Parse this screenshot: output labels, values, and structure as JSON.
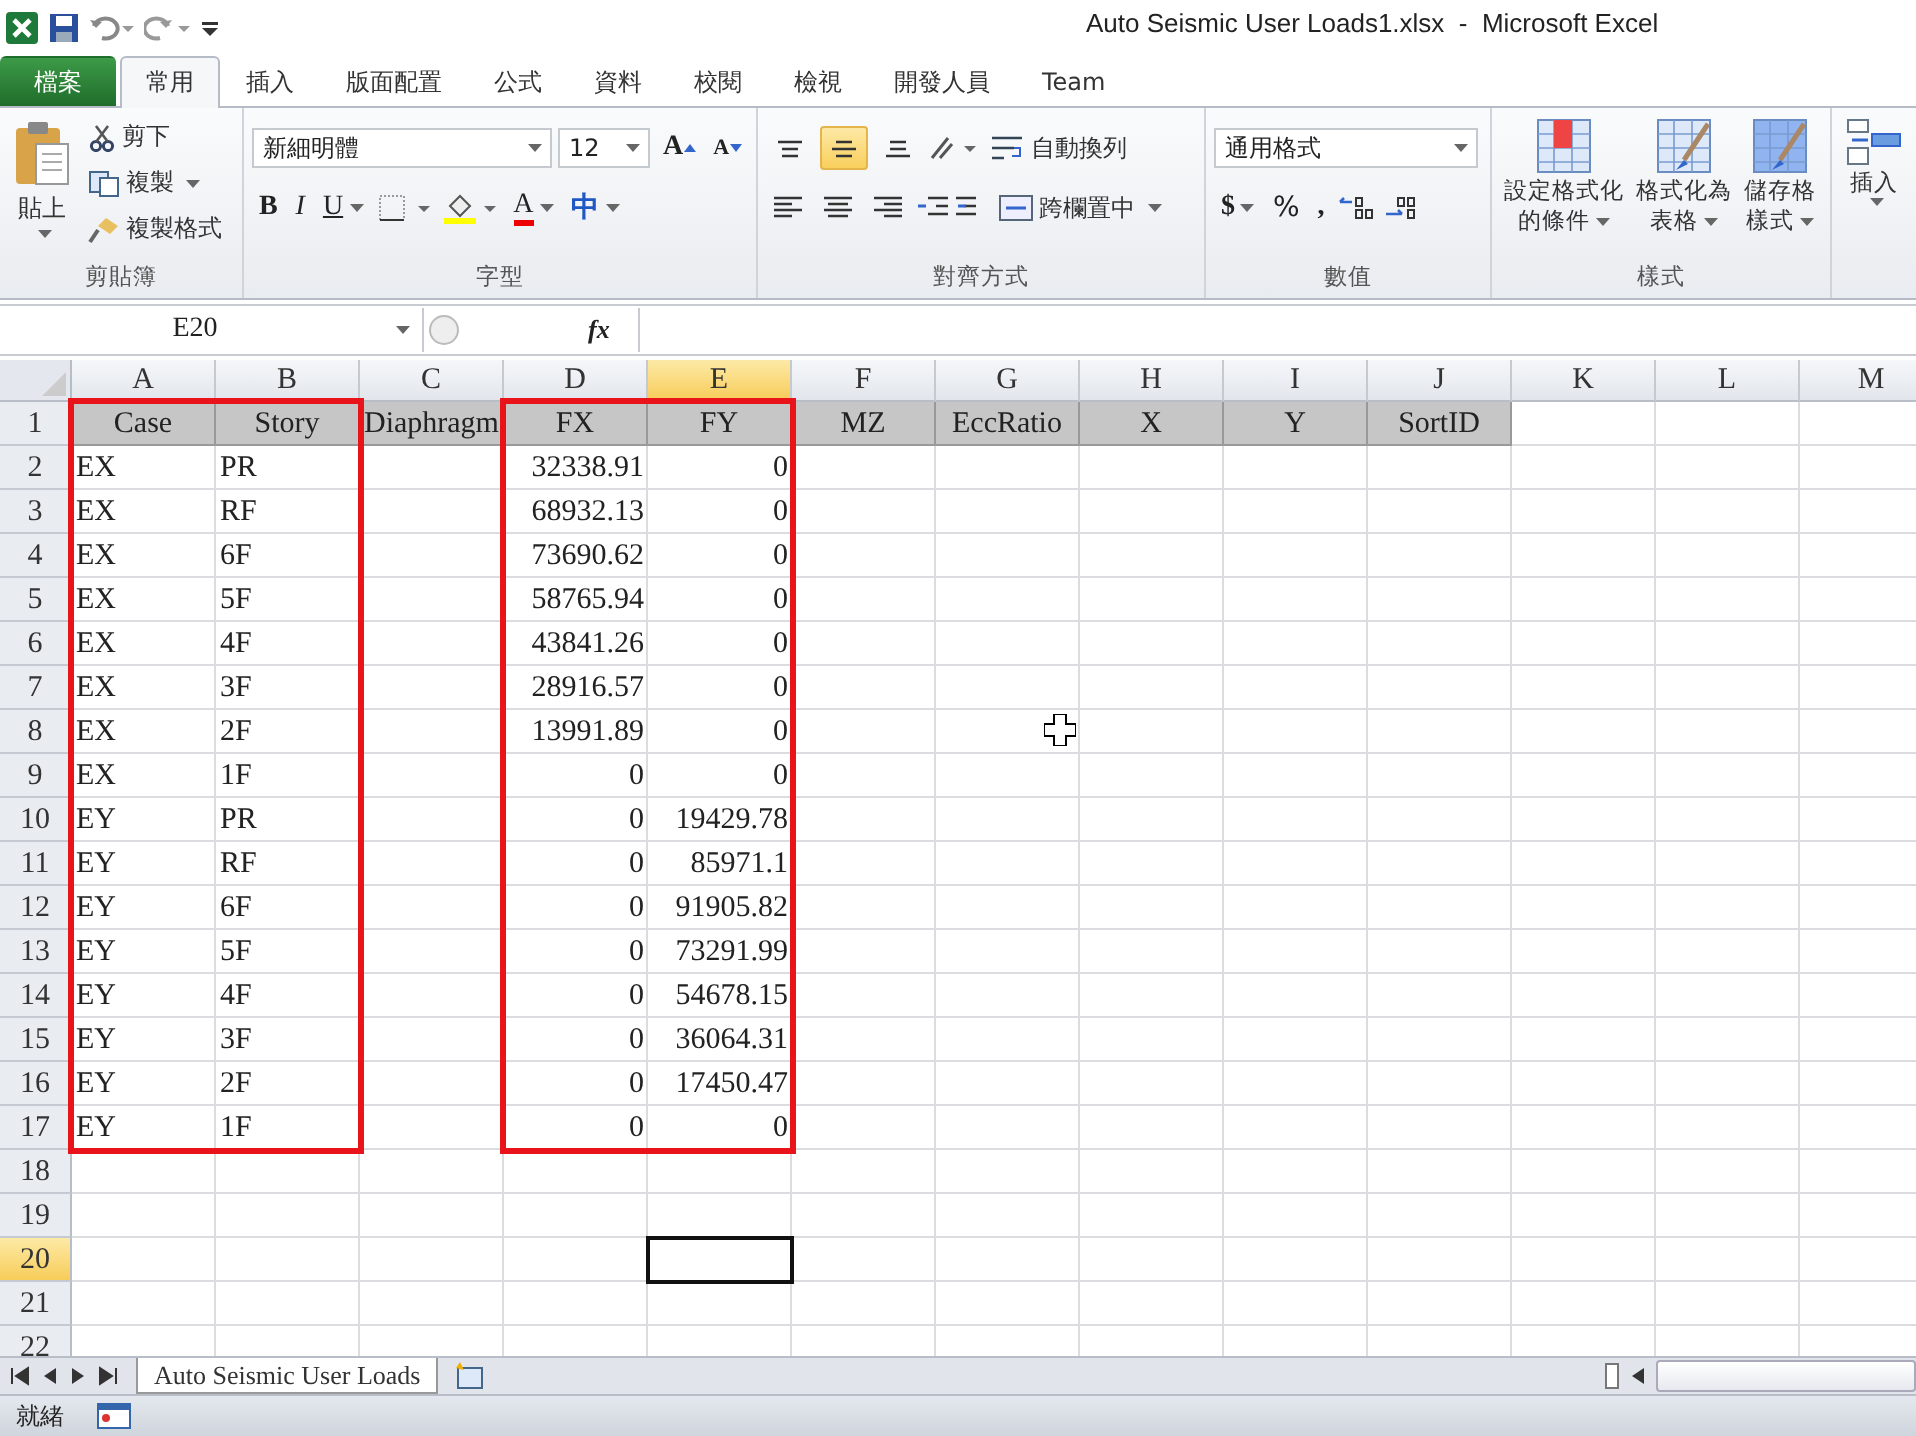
{
  "window": {
    "title": "Auto Seismic User Loads1.xlsx  -  Microsoft Excel"
  },
  "ribbon_tabs": [
    {
      "label": "檔案",
      "kind": "file",
      "selected": false
    },
    {
      "label": "常用",
      "kind": "tab",
      "selected": true
    },
    {
      "label": "插入",
      "kind": "tab",
      "selected": false
    },
    {
      "label": "版面配置",
      "kind": "tab",
      "selected": false
    },
    {
      "label": "公式",
      "kind": "tab",
      "selected": false
    },
    {
      "label": "資料",
      "kind": "tab",
      "selected": false
    },
    {
      "label": "校閱",
      "kind": "tab",
      "selected": false
    },
    {
      "label": "檢視",
      "kind": "tab",
      "selected": false
    },
    {
      "label": "開發人員",
      "kind": "tab",
      "selected": false
    },
    {
      "label": "Team",
      "kind": "tab",
      "selected": false
    }
  ],
  "ribbon": {
    "clipboard": {
      "paste": "貼上",
      "cut": "剪下",
      "copy": "複製",
      "format_painter": "複製格式",
      "group_label": "剪貼簿"
    },
    "font": {
      "font_name": "新細明體",
      "font_size": "12",
      "grow": "A",
      "shrink": "A",
      "bold": "B",
      "italic": "I",
      "underline": "U",
      "font_color": "A",
      "phonetic": "中",
      "group_label": "字型"
    },
    "alignment": {
      "vertical_align": [
        {
          "selected": false
        },
        {
          "selected": true
        },
        {
          "selected": false
        }
      ],
      "wrap_text": "自動換列",
      "merge_center": "跨欄置中",
      "group_label": "對齊方式"
    },
    "number": {
      "format": "通用格式",
      "currency": "$",
      "percent": "%",
      "comma": ",",
      "group_label": "數值"
    },
    "styles": {
      "buttons": [
        {
          "lines": [
            "設定格式化",
            "的條件"
          ]
        },
        {
          "lines": [
            "格式化為",
            "表格"
          ]
        },
        {
          "lines": [
            "儲存格",
            "樣式"
          ]
        }
      ],
      "group_label": "樣式"
    },
    "cells": {
      "insert": "插入"
    }
  },
  "formula_bar": {
    "name_box": "E20",
    "fx": "fx"
  },
  "sheet": {
    "columns": [
      {
        "letter": "A",
        "selected": false,
        "boxed": true
      },
      {
        "letter": "B",
        "selected": false,
        "boxed": true
      },
      {
        "letter": "C",
        "selected": false,
        "boxed": false
      },
      {
        "letter": "D",
        "selected": false,
        "boxed": true
      },
      {
        "letter": "E",
        "selected": true,
        "boxed": true
      },
      {
        "letter": "F",
        "selected": false,
        "boxed": false
      },
      {
        "letter": "G",
        "selected": false,
        "boxed": false
      },
      {
        "letter": "H",
        "selected": false,
        "boxed": false
      },
      {
        "letter": "I",
        "selected": false,
        "boxed": false
      },
      {
        "letter": "J",
        "selected": false,
        "boxed": false
      },
      {
        "letter": "K",
        "selected": false,
        "boxed": false
      },
      {
        "letter": "L",
        "selected": false,
        "boxed": false
      },
      {
        "letter": "M",
        "selected": false,
        "boxed": false
      }
    ],
    "rows": [
      {
        "label": "1",
        "selected": false,
        "kind": "header",
        "cells": [
          "Case",
          "Story",
          "Diaphragm",
          "FX",
          "FY",
          "MZ",
          "EccRatio",
          "X",
          "Y",
          "SortID"
        ]
      },
      {
        "label": "2",
        "selected": false,
        "kind": "data",
        "case": "EX",
        "story": "PR",
        "fx": "32338.91",
        "fy": "0"
      },
      {
        "label": "3",
        "selected": false,
        "kind": "data",
        "case": "EX",
        "story": "RF",
        "fx": "68932.13",
        "fy": "0"
      },
      {
        "label": "4",
        "selected": false,
        "kind": "data",
        "case": "EX",
        "story": "6F",
        "fx": "73690.62",
        "fy": "0"
      },
      {
        "label": "5",
        "selected": false,
        "kind": "data",
        "case": "EX",
        "story": "5F",
        "fx": "58765.94",
        "fy": "0"
      },
      {
        "label": "6",
        "selected": false,
        "kind": "data",
        "case": "EX",
        "story": "4F",
        "fx": "43841.26",
        "fy": "0"
      },
      {
        "label": "7",
        "selected": false,
        "kind": "data",
        "case": "EX",
        "story": "3F",
        "fx": "28916.57",
        "fy": "0"
      },
      {
        "label": "8",
        "selected": false,
        "kind": "data",
        "case": "EX",
        "story": "2F",
        "fx": "13991.89",
        "fy": "0"
      },
      {
        "label": "9",
        "selected": false,
        "kind": "data",
        "case": "EX",
        "story": "1F",
        "fx": "0",
        "fy": "0"
      },
      {
        "label": "10",
        "selected": false,
        "kind": "data",
        "case": "EY",
        "story": "PR",
        "fx": "0",
        "fy": "19429.78"
      },
      {
        "label": "11",
        "selected": false,
        "kind": "data",
        "case": "EY",
        "story": "RF",
        "fx": "0",
        "fy": "85971.1"
      },
      {
        "label": "12",
        "selected": false,
        "kind": "data",
        "case": "EY",
        "story": "6F",
        "fx": "0",
        "fy": "91905.82"
      },
      {
        "label": "13",
        "selected": false,
        "kind": "data",
        "case": "EY",
        "story": "5F",
        "fx": "0",
        "fy": "73291.99"
      },
      {
        "label": "14",
        "selected": false,
        "kind": "data",
        "case": "EY",
        "story": "4F",
        "fx": "0",
        "fy": "54678.15"
      },
      {
        "label": "15",
        "selected": false,
        "kind": "data",
        "case": "EY",
        "story": "3F",
        "fx": "0",
        "fy": "36064.31"
      },
      {
        "label": "16",
        "selected": false,
        "kind": "data",
        "case": "EY",
        "story": "2F",
        "fx": "0",
        "fy": "17450.47"
      },
      {
        "label": "17",
        "selected": false,
        "kind": "data",
        "case": "EY",
        "story": "1F",
        "fx": "0",
        "fy": "0"
      },
      {
        "label": "18",
        "selected": false,
        "kind": "empty"
      },
      {
        "label": "19",
        "selected": false,
        "kind": "empty"
      },
      {
        "label": "20",
        "selected": true,
        "kind": "empty"
      },
      {
        "label": "21",
        "selected": false,
        "kind": "empty"
      },
      {
        "label": "22",
        "selected": false,
        "kind": "empty"
      }
    ]
  },
  "sheet_tabs": [
    {
      "label": "Auto Seismic User Loads",
      "selected": true
    }
  ],
  "status_bar": {
    "text": "就緒"
  }
}
